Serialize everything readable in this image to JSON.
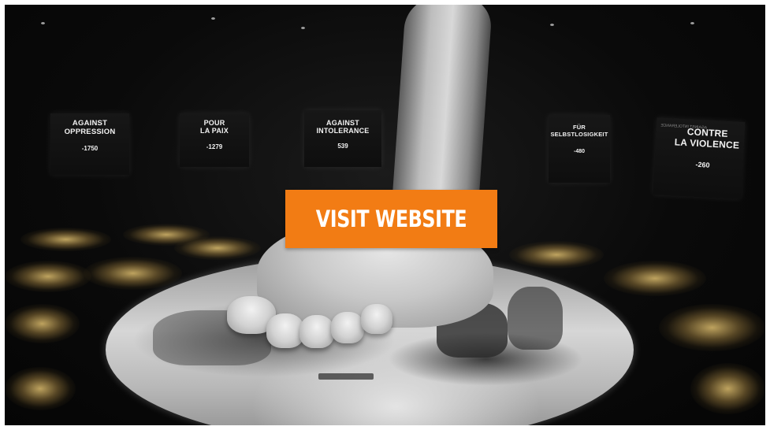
{
  "cta": {
    "label": "VISIT WEBSITE",
    "color": "#f27c14"
  },
  "panels": [
    {
      "title_line1": "AGAINST",
      "title_line2": "OPPRESSION",
      "year": "-1750"
    },
    {
      "title_line1": "POUR",
      "title_line2": "LA PAIX",
      "year": "-1279"
    },
    {
      "title_line1": "AGAINST",
      "title_line2": "INTOLERANCE",
      "year": "539"
    },
    {
      "title_line1": "FÜR",
      "title_line2": "SELBSTLOSIGKEIT",
      "year": "-480"
    },
    {
      "mirrored": "AGAINST INTOLERANCE",
      "title_line1": "CONTRE",
      "title_line2": "LA VIOLENCE",
      "year": "-260"
    }
  ]
}
